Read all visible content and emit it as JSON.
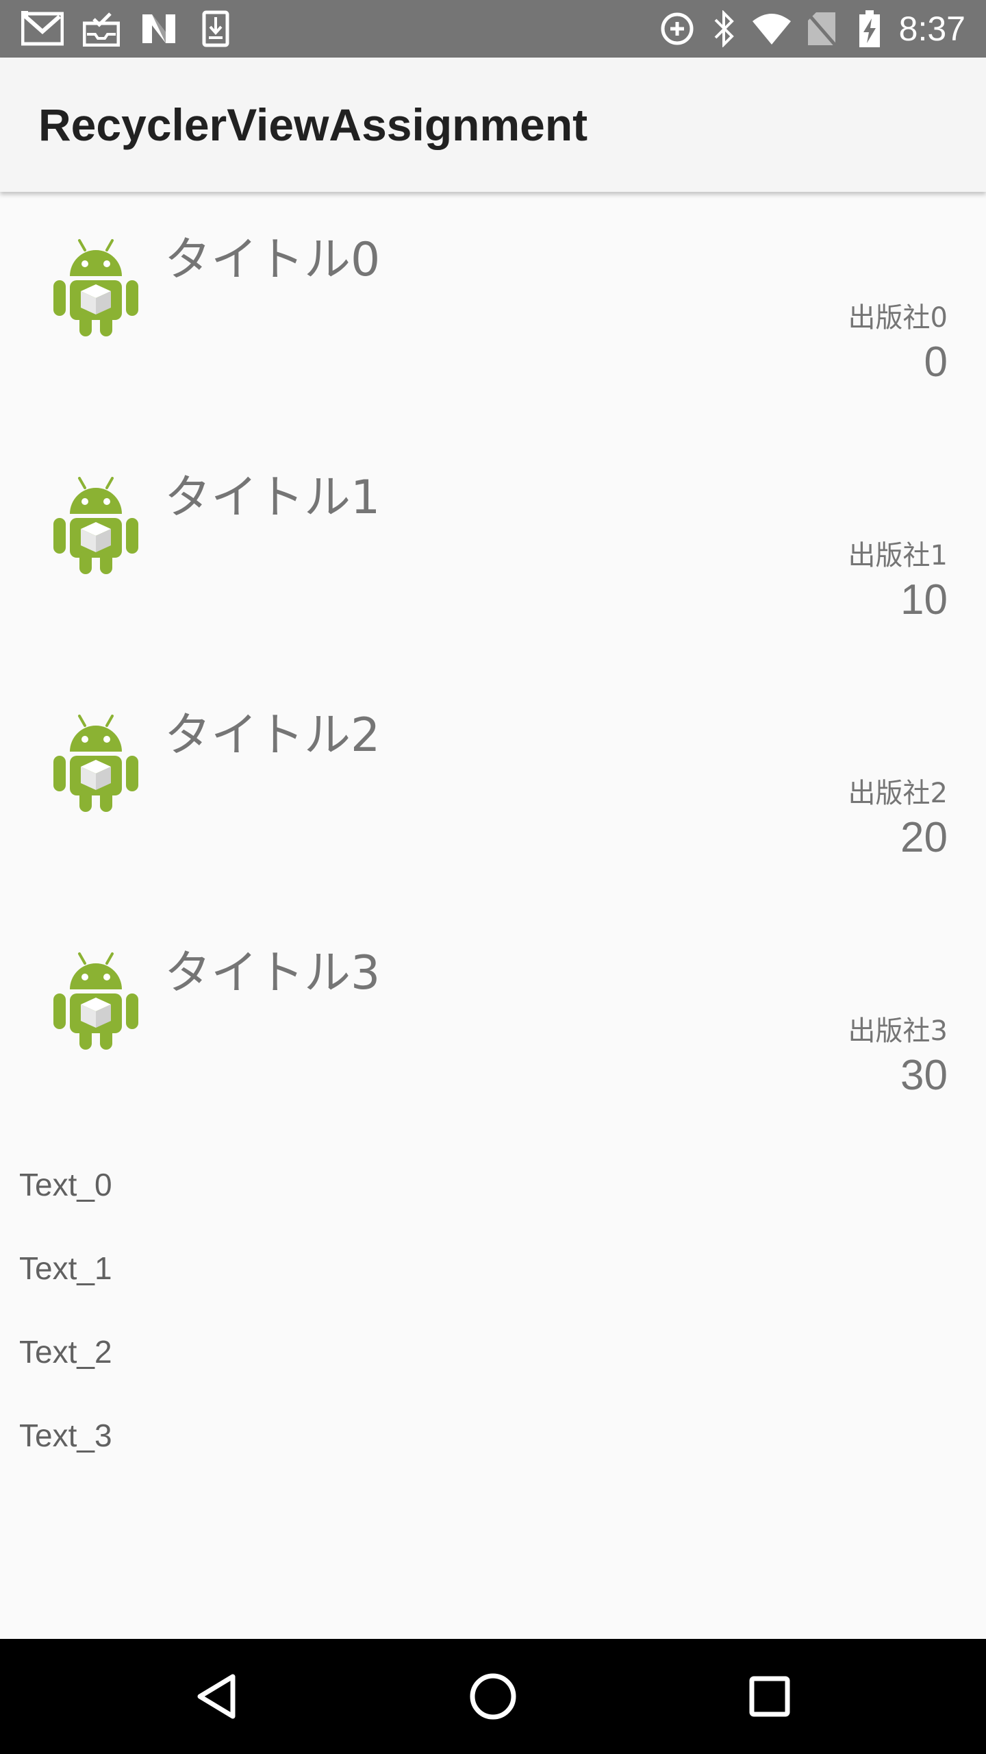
{
  "status_bar": {
    "time": "8:37",
    "left_icons": [
      "gmail-icon",
      "inbox-icon",
      "n-logo-icon",
      "download-icon"
    ],
    "right_icons": [
      "data-saver-icon",
      "bluetooth-icon",
      "wifi-icon",
      "no-sim-icon",
      "battery-charging-icon"
    ],
    "background": "#757575"
  },
  "app_bar": {
    "title": "RecyclerViewAssignment"
  },
  "books": [
    {
      "title": "タイトル0",
      "publisher": "出版社0",
      "price": "0",
      "icon": "android-robot-icon"
    },
    {
      "title": "タイトル1",
      "publisher": "出版社1",
      "price": "10",
      "icon": "android-robot-icon"
    },
    {
      "title": "タイトル2",
      "publisher": "出版社2",
      "price": "20",
      "icon": "android-robot-icon"
    },
    {
      "title": "タイトル3",
      "publisher": "出版社3",
      "price": "30",
      "icon": "android-robot-icon"
    }
  ],
  "text_items": [
    "Text_0",
    "Text_1",
    "Text_2",
    "Text_3"
  ],
  "nav_bar": {
    "buttons": [
      "back-icon",
      "home-icon",
      "recents-icon"
    ]
  },
  "colors": {
    "android_green": "#8bb233",
    "text_gray": "#757575"
  }
}
